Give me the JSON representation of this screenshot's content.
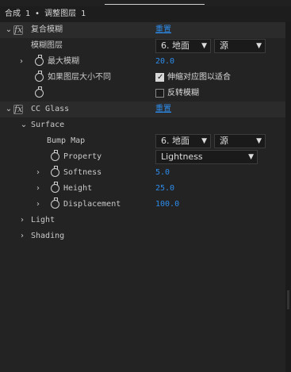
{
  "header": {
    "title": "合成 1 • 调整图层 1"
  },
  "rows": {
    "composite_blur": {
      "name": "复合模糊",
      "reset": "重置"
    },
    "blur_layer": {
      "label": "模糊图层",
      "layer": "6. 地面",
      "source": "源"
    },
    "max_blur": {
      "label": "最大模糊",
      "value": "20.0"
    },
    "fit_layer": {
      "label": "如果图层大小不同",
      "checkbox_label": "伸缩对应图以适合",
      "checked": true
    },
    "invert_blur": {
      "checkbox_label": "反转模糊",
      "checked": false
    },
    "cc_glass": {
      "name": "CC Glass",
      "reset": "重置"
    },
    "surface": {
      "label": "Surface"
    },
    "bump_map": {
      "label": "Bump Map",
      "layer": "6. 地面",
      "source": "源"
    },
    "property": {
      "label": "Property",
      "value": "Lightness"
    },
    "softness": {
      "label": "Softness",
      "value": "5.0"
    },
    "height": {
      "label": "Height",
      "value": "25.0"
    },
    "displacement": {
      "label": "Displacement",
      "value": "100.0"
    },
    "light": {
      "label": "Light"
    },
    "shading": {
      "label": "Shading"
    }
  },
  "icons": {
    "effect": "fx-icon",
    "stopwatch": "stopwatch-icon",
    "expand": "chevron-right-icon",
    "collapse": "chevron-down-icon",
    "dropdown": "chevron-down-icon"
  },
  "colors": {
    "link": "#2d8ceb",
    "panel": "#232323",
    "section": "#2b2b2b"
  }
}
